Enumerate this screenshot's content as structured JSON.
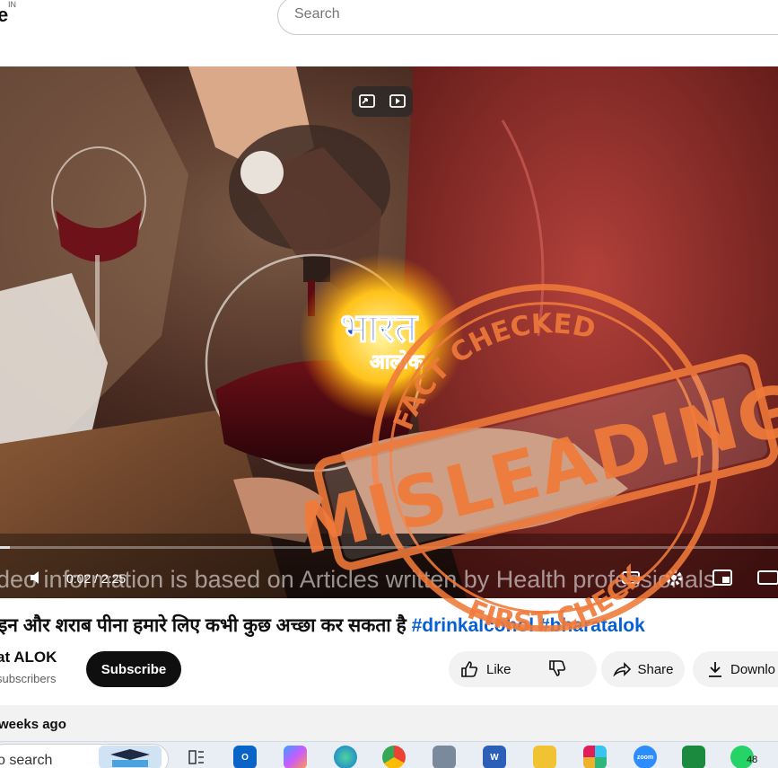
{
  "header": {
    "logo_fragment": "e",
    "region_code": "IN",
    "search_placeholder": "Search"
  },
  "player": {
    "watermark_top": "भारत",
    "watermark_bottom": "आलोक",
    "subtitle": "deo information is based on Articles written by Health professionals",
    "time_display": "0:02 / 2:25",
    "progress_fraction": 0.013,
    "stamp": {
      "top_text": "FACT CHECKED",
      "main_text": "MISLEADING",
      "bottom_text": "FIRST CHECK",
      "color": "#f07a3a"
    }
  },
  "video": {
    "title_text": "इन और शराब पीना हमारे लिए कभी कुछ अच्छा कर सकता है",
    "hashtags": "#drinkalcohol #bharatalok",
    "channel_name": "at ALOK",
    "subscribers": "subscribers",
    "subscribe_label": "Subscribe",
    "like_label": "Like",
    "share_label": "Share",
    "download_label": "Downlo",
    "upload_date": "weeks ago"
  },
  "taskbar": {
    "search_text": "o search",
    "whatsapp_badge": "48",
    "zoom_label": "zoom"
  },
  "colors": {
    "link_blue": "#065fd4",
    "stamp_orange": "#f07a3a",
    "subscribe_bg": "#0f0f0f"
  }
}
